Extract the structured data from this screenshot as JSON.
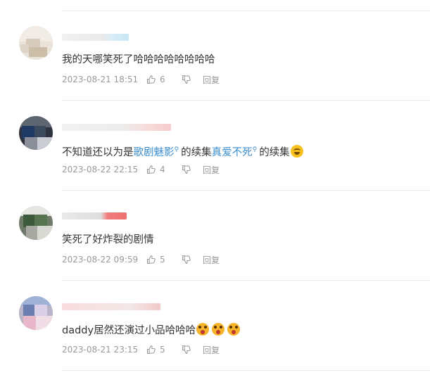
{
  "comments": [
    {
      "text": "我的天哪笑死了哈哈哈哈哈哈哈哈",
      "time": "2023-08-21 18:51",
      "likes": "6",
      "reply_label": "回复"
    },
    {
      "text_parts": [
        "不知道还以为是",
        "歌剧魅影",
        "的续集",
        "真爱不死",
        "的续集"
      ],
      "emoji": "laughing-tears-emoji",
      "time": "2023-08-22 22:15",
      "likes": "4",
      "reply_label": "回复"
    },
    {
      "text": "笑死了好炸裂的剧情",
      "time": "2023-08-22 09:59",
      "likes": "5",
      "reply_label": "回复"
    },
    {
      "text": "daddy居然还演过小品哈哈哈",
      "emoji": "screaming-face-emoji",
      "time": "2023-08-21 23:15",
      "likes": "5",
      "reply_label": "回复"
    }
  ],
  "colors": {
    "link": "#3a8dd0",
    "meta_text": "#999999",
    "body_text": "#333333",
    "divider": "#ececec"
  }
}
